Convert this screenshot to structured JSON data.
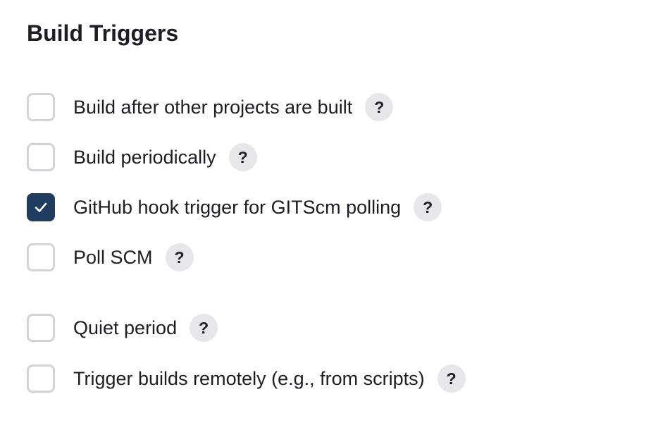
{
  "section": {
    "title": "Build Triggers"
  },
  "help_glyph": "?",
  "triggers": [
    {
      "label": "Build after other projects are built",
      "checked": false,
      "has_help": true
    },
    {
      "label": "Build periodically",
      "checked": false,
      "has_help": true
    },
    {
      "label": "GitHub hook trigger for GITScm polling",
      "checked": true,
      "has_help": true
    },
    {
      "label": "Poll SCM",
      "checked": false,
      "has_help": true
    },
    {
      "label": "Quiet period",
      "checked": false,
      "has_help": true
    },
    {
      "label": "Trigger builds remotely (e.g., from scripts)",
      "checked": false,
      "has_help": true
    }
  ],
  "colors": {
    "checked_fill": "#1f3d5e",
    "unchecked_border": "#d4d4d8",
    "help_bg": "#e7e7ea",
    "text": "#1d1d23"
  }
}
